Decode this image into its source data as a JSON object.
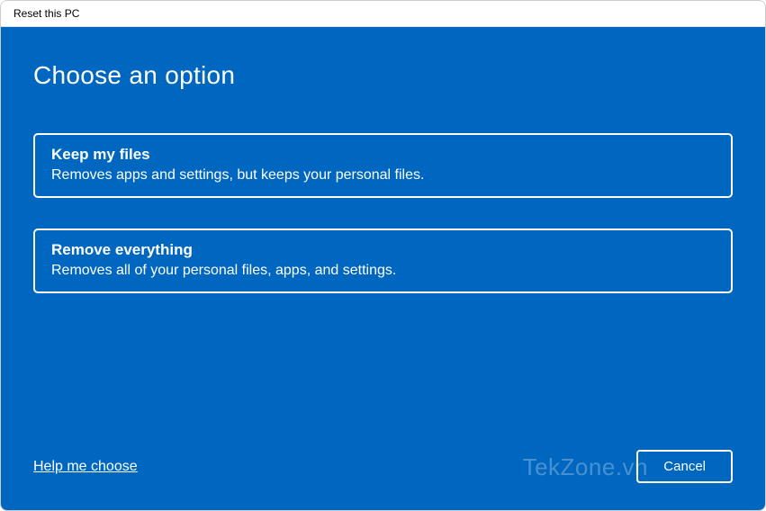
{
  "window": {
    "title": "Reset this PC"
  },
  "main": {
    "heading": "Choose an option",
    "options": [
      {
        "title": "Keep my files",
        "description": "Removes apps and settings, but keeps your personal files."
      },
      {
        "title": "Remove everything",
        "description": "Removes all of your personal files, apps, and settings."
      }
    ]
  },
  "footer": {
    "help_link": "Help me choose",
    "cancel_label": "Cancel"
  },
  "watermark": "TekZone.vn"
}
